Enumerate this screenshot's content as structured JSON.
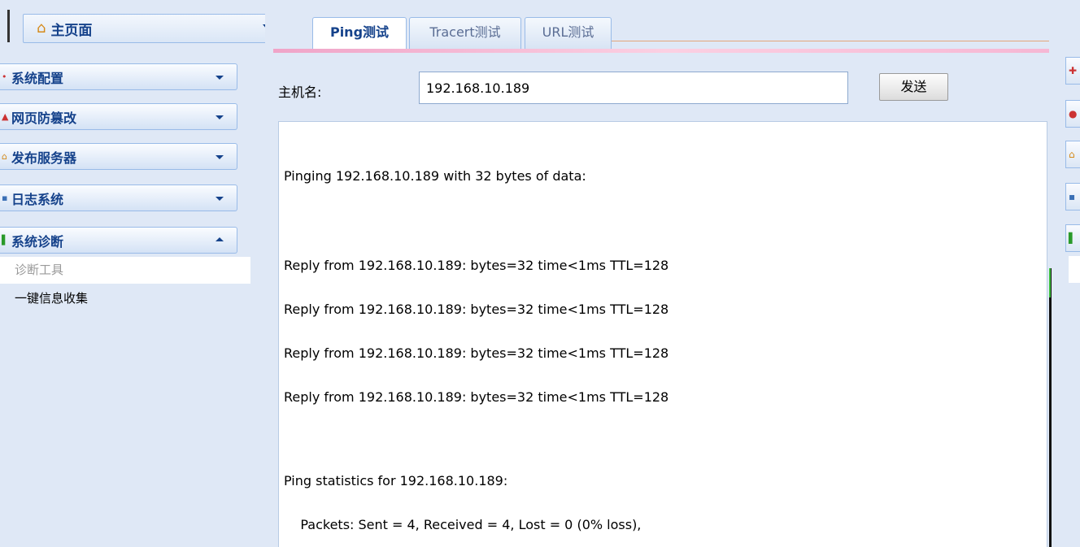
{
  "sidebar": {
    "home_title": "主页面",
    "groups": [
      {
        "label": "系统配置",
        "icon": "gear-icon",
        "expanded": false
      },
      {
        "label": "网页防篡改",
        "icon": "shield-icon",
        "expanded": false
      },
      {
        "label": "发布服务器",
        "icon": "home-icon",
        "expanded": false
      },
      {
        "label": "日志系统",
        "icon": "log-icon",
        "expanded": false
      },
      {
        "label": "系统诊断",
        "icon": "diagnose-icon",
        "expanded": true
      }
    ],
    "subitems": [
      {
        "label": "诊断工具",
        "selected": true
      },
      {
        "label": "一键信息收集",
        "selected": false
      }
    ]
  },
  "tabs": [
    {
      "label": "Ping测试",
      "active": true
    },
    {
      "label": "Tracert测试",
      "active": false
    },
    {
      "label": "URL测试",
      "active": false
    }
  ],
  "form": {
    "host_label": "主机名:",
    "host_value": "192.168.10.189",
    "send_label": "发送"
  },
  "output": {
    "lines": [
      "Pinging 192.168.10.189 with 32 bytes of data:",
      "Reply from 192.168.10.189: bytes=32 time<1ms TTL=128",
      "Reply from 192.168.10.189: bytes=32 time<1ms TTL=128",
      "Reply from 192.168.10.189: bytes=32 time<1ms TTL=128",
      "Reply from 192.168.10.189: bytes=32 time<1ms TTL=128",
      "Ping statistics for 192.168.10.189:",
      "    Packets: Sent = 4, Received = 4, Lost = 0 (0% loss),"
    ]
  },
  "colors": {
    "header_text": "#15428b",
    "panel_bg": "#dfe8f6",
    "border": "#99bbe8"
  }
}
